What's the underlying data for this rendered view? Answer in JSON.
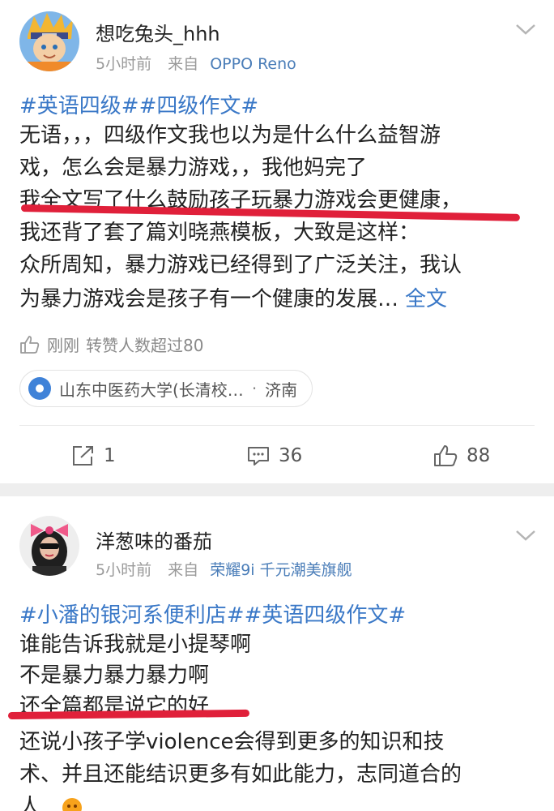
{
  "post1": {
    "username": "想吃兔头_hhh",
    "time": "5小时前",
    "source_prefix": "来自",
    "source": "OPPO Reno",
    "hashtags": "#英语四级##四级作文#",
    "lines": [
      "无语，，，四级作文我也以为是什么什么益智游",
      "戏，怎么会是暴力游戏，，我他妈完了",
      "我全文写了什么鼓励孩子玩暴力游戏会更健康，",
      "我还背了套了篇刘晓燕模板，大致是这样：",
      "众所周知，暴力游戏已经得到了广泛关注，我认",
      "为暴力游戏会是孩子有一个健康的发展…"
    ],
    "more_label": "全文",
    "status_time": "刚刚",
    "status_text": "转赞人数超过80",
    "location": "山东中医药大学(长清校…",
    "location_sep": "·",
    "city": "济南",
    "repost_count": "1",
    "comment_count": "36",
    "like_count": "88"
  },
  "post2": {
    "username": "洋葱味的番茄",
    "time": "5小时前",
    "source_prefix": "来自",
    "source": "荣耀9i 千元潮美旗舰",
    "hashtags": "#小潘的银河系便利店##英语四级作文#",
    "lines": [
      "谁能告诉我就是小提琴啊",
      "不是暴力暴力暴力啊",
      "还全篇都是说它的好",
      "还说小孩子学violence会得到更多的知识和技",
      "术、并且还能结识更多有如此能力，志同道合的",
      "人"
    ]
  },
  "colors": {
    "link": "#3a78c7",
    "underline": "#e0203a",
    "location_icon": "#3f82d8"
  }
}
